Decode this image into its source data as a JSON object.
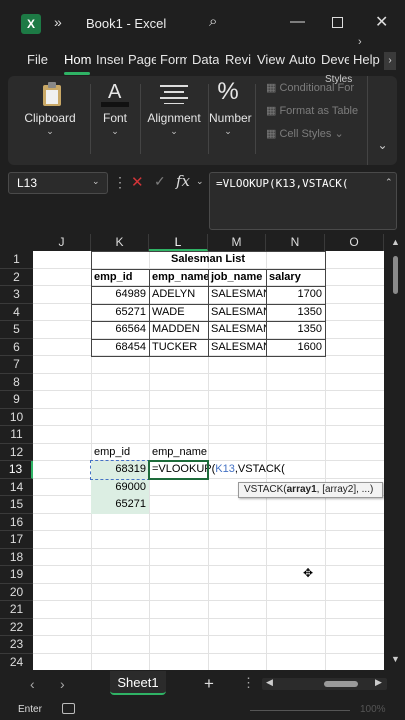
{
  "window": {
    "app_icon": "excel-logo",
    "app_letter": "X",
    "chevron": "»",
    "title": "Book1  -  Excel",
    "search_icon": "search-icon"
  },
  "tabs": [
    "File",
    "Hom",
    "Inser",
    "Page",
    "Form",
    "Data",
    "Revie",
    "View",
    "Auto",
    "Deve",
    "Help"
  ],
  "ribbon": {
    "groups": [
      "Clipboard",
      "Font",
      "Alignment",
      "Number"
    ],
    "styles_items": [
      "Conditional For",
      "Format as Table",
      "Cell Styles"
    ],
    "styles_label": "Styles"
  },
  "formula_bar": {
    "name_box": "L13",
    "formula": "=VLOOKUP(K13,VSTACK("
  },
  "grid": {
    "columns": [
      "J",
      "K",
      "L",
      "M",
      "N",
      "O"
    ],
    "selected_column": "L",
    "rows": [
      "1",
      "2",
      "3",
      "4",
      "5",
      "6",
      "7",
      "8",
      "9",
      "10",
      "11",
      "12",
      "13",
      "14",
      "15",
      "16",
      "17",
      "18",
      "19",
      "20",
      "21",
      "22",
      "23",
      "24"
    ],
    "selected_row": "13"
  },
  "table": {
    "title": "Salesman List",
    "headers": [
      "emp_id",
      "emp_name",
      "job_name",
      "salary"
    ],
    "rows": [
      [
        "64989",
        "ADELYN",
        "SALESMAN",
        "1700"
      ],
      [
        "65271",
        "WADE",
        "SALESMAN",
        "1350"
      ],
      [
        "66564",
        "MADDEN",
        "SALESMAN",
        "1350"
      ],
      [
        "68454",
        "TUCKER",
        "SALESMAN",
        "1600"
      ]
    ]
  },
  "lookup": {
    "header_id": "emp_id",
    "header_name": "emp_name",
    "ids": [
      "68319",
      "69000",
      "65271"
    ],
    "editing_formula_prefix": "=VLOOKUP(",
    "editing_formula_ref": "K13",
    "editing_formula_suffix": ",VSTACK("
  },
  "tooltip": {
    "fn": "VSTACK(",
    "arg1": "array1",
    "rest": ", [array2], ...)"
  },
  "sheets": {
    "active": "Sheet1",
    "add": "+"
  },
  "status": {
    "mode": "Enter",
    "zoom": "100%"
  },
  "colors": {
    "accent": "#2fb365",
    "ref_blue": "#4472c4",
    "cancel_red": "#d13438"
  }
}
